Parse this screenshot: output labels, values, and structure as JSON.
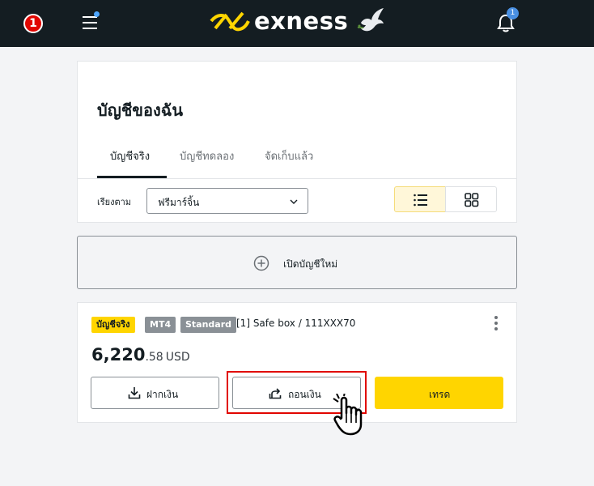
{
  "tutorial": {
    "step": "1"
  },
  "header": {
    "brand": "exness",
    "brand_color": "#ffd500",
    "notification_count": "1",
    "icons": [
      "menu-icon",
      "dove-icon",
      "bell-icon"
    ]
  },
  "accounts_page": {
    "title": "บัญชีของฉัน",
    "tabs": [
      {
        "label": "บัญชีจริง",
        "active": true
      },
      {
        "label": "บัญชีทดลอง",
        "active": false
      },
      {
        "label": "จัดเก็บแล้ว",
        "active": false
      }
    ],
    "sort": {
      "label": "เรียงตาม",
      "value": "ฟรีมาร์จิ้น"
    },
    "view_modes": [
      "list",
      "grid"
    ],
    "selected_view": "list"
  },
  "new_account": {
    "label": "เปิดบัญชีใหม่"
  },
  "account": {
    "badges": {
      "type": "บัญชีจริง",
      "platform": "MT4",
      "kind": "Standard"
    },
    "name": "[1] Safe box / 111XXX70",
    "balance_int": "6,220",
    "balance_dec": ".58",
    "currency": "USD",
    "actions": {
      "deposit": "ฝากเงิน",
      "withdraw": "ถอนเงิน",
      "trade": "เทรด"
    }
  },
  "colors": {
    "accent": "#ffd500",
    "highlight": "#e10600",
    "topbar": "#141d22"
  }
}
